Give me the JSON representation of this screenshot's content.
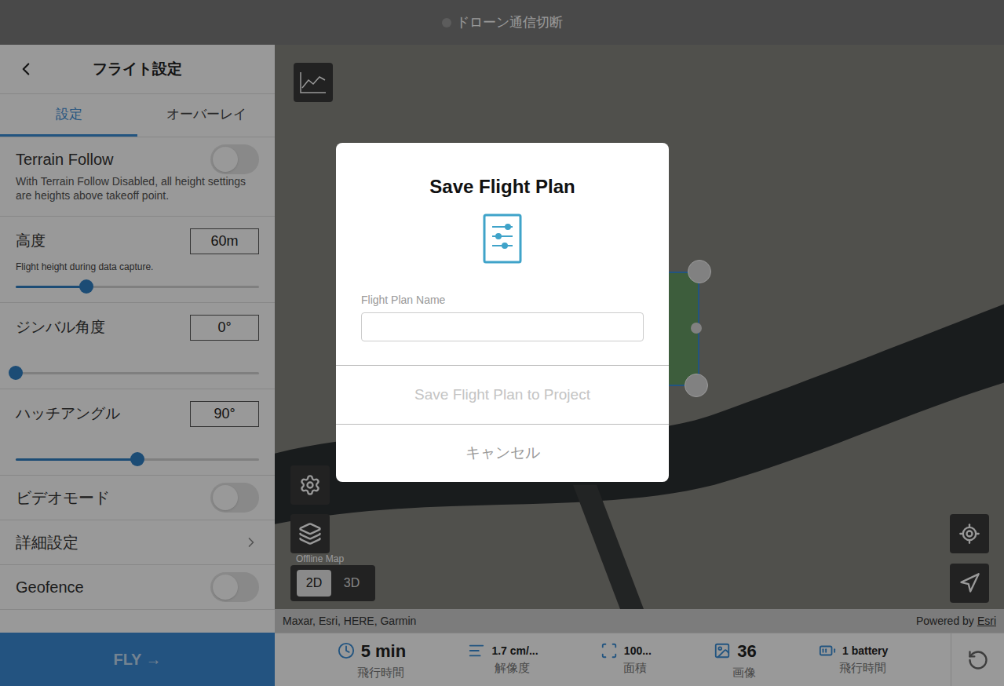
{
  "status_bar": {
    "text": "ドローン通信切断",
    "connected": false
  },
  "sidebar": {
    "title": "フライト設定",
    "tabs": [
      {
        "label": "設定",
        "selected": true
      },
      {
        "label": "オーバーレイ",
        "selected": false
      }
    ],
    "settings": [
      {
        "kind": "toggle",
        "label": "Terrain Follow",
        "description": "With Terrain Follow Disabled, all height settings are heights above takeoff point.",
        "on": false
      },
      {
        "kind": "slider",
        "label": "高度",
        "value": "60m",
        "hint": "Flight height during data capture.",
        "level": 0.29
      },
      {
        "kind": "slider",
        "label": "ジンバル角度",
        "value": "0°",
        "hint": "",
        "level": 0
      },
      {
        "kind": "slider",
        "label": "ハッチアングル",
        "value": "90°",
        "hint": "",
        "level": 0.5
      },
      {
        "kind": "toggle",
        "label": "ビデオモード",
        "description": "",
        "on": false
      },
      {
        "kind": "link",
        "label": "詳細設定"
      },
      {
        "kind": "toggle",
        "label": "Geofence",
        "description": "",
        "on": false
      }
    ],
    "fly_button": "FLY →"
  },
  "map": {
    "offline_label": "Offline Map",
    "view_modes": [
      {
        "label": "2D",
        "selected": true
      },
      {
        "label": "3D",
        "selected": false
      }
    ],
    "attribution": "Maxar, Esri, HERE, Garmin",
    "powered_by": "Powered by",
    "powered_link": "Esri"
  },
  "stats": [
    {
      "value": "5 min",
      "label": "飛行時間"
    },
    {
      "value": "1.7 cm/...",
      "label": "解像度"
    },
    {
      "value": "100...",
      "label": "面積"
    },
    {
      "value": "36",
      "label": "画像"
    },
    {
      "value": "1 battery",
      "label": "飛行時間"
    }
  ],
  "dialog": {
    "title": "Save Flight Plan",
    "field_label": "Flight Plan Name",
    "field_value": "",
    "save_button": "Save Flight Plan to Project",
    "save_disabled": true,
    "cancel_button": "キャンセル"
  }
}
